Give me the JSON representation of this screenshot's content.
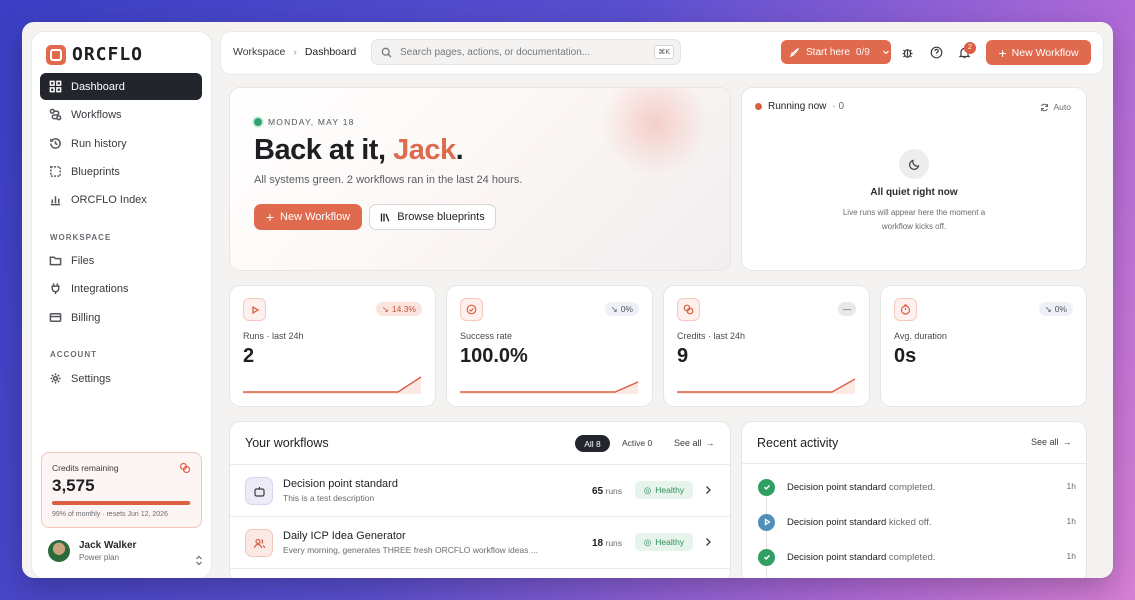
{
  "brand": {
    "name": "ORCFLO",
    "accent": "#e06a4e"
  },
  "sidebar": {
    "nav": [
      {
        "label": "Dashboard",
        "icon": "grid-icon",
        "active": true
      },
      {
        "label": "Workflows",
        "icon": "workflow-icon"
      },
      {
        "label": "Run history",
        "icon": "history-icon"
      },
      {
        "label": "Blueprints",
        "icon": "blueprint-icon"
      },
      {
        "label": "ORCFLO Index",
        "icon": "bar-chart-icon"
      }
    ],
    "workspace_label": "WORKSPACE",
    "workspace": [
      {
        "label": "Files",
        "icon": "folder-icon"
      },
      {
        "label": "Integrations",
        "icon": "plug-icon"
      },
      {
        "label": "Billing",
        "icon": "card-icon"
      }
    ],
    "account_label": "ACCOUNT",
    "account": [
      {
        "label": "Settings",
        "icon": "gear-icon"
      }
    ],
    "credits": {
      "label": "Credits remaining",
      "value": "3,575",
      "percent": 99,
      "sub": "99% of monthly · resets Jun 12, 2026"
    },
    "user": {
      "name": "Jack Walker",
      "plan": "Power plan"
    }
  },
  "topbar": {
    "crumb_root": "Workspace",
    "crumb_sep": "›",
    "crumb_current": "Dashboard",
    "search_placeholder": "Search pages, actions, or documentation...",
    "search_kbd": "⌘K",
    "start_here": "Start here",
    "start_progress": "0/9",
    "notif_count": "2",
    "new_workflow": "New Workflow"
  },
  "hero": {
    "date": "MONDAY, MAY 18",
    "greeting": "Back at it, ",
    "name": "Jack",
    "punct": ".",
    "status": "All systems green. 2 workflows ran in the last 24 hours.",
    "primary": "New Workflow",
    "secondary": "Browse blueprints"
  },
  "running": {
    "title": "Running now",
    "count": "· 0",
    "auto": "Auto",
    "empty_title": "All quiet right now",
    "empty_sub": "Live runs will appear here the moment a workflow kicks off."
  },
  "stats": [
    {
      "label": "Runs · last 24h",
      "value": "2",
      "change": "14.3%",
      "tone": "down"
    },
    {
      "label": "Success rate",
      "value": "100.0%",
      "change": "0%",
      "tone": "neutral"
    },
    {
      "label": "Credits · last 24h",
      "value": "9",
      "change": "—",
      "tone": "flat"
    },
    {
      "label": "Avg. duration",
      "value": "0s",
      "change": "0%",
      "tone": "neutral"
    }
  ],
  "workflows": {
    "title": "Your workflows",
    "filter_all": "All 8",
    "filter_active": "Active 0",
    "see_all": "See all",
    "rows": [
      {
        "title": "Decision point standard",
        "desc": "This is a test description",
        "runs": "65",
        "runs_unit": "runs",
        "status": "Healthy"
      },
      {
        "title": "Daily ICP Idea Generator",
        "desc": "Every morning, generates THREE fresh ORCFLO workflow ideas ...",
        "runs": "18",
        "runs_unit": "runs",
        "status": "Healthy"
      }
    ]
  },
  "activity": {
    "title": "Recent activity",
    "see_all": "See all",
    "rows": [
      {
        "name": "Decision point standard",
        "verb": " completed.",
        "time": "1h",
        "kind": "done"
      },
      {
        "name": "Decision point standard",
        "verb": " kicked off.",
        "time": "1h",
        "kind": "start"
      },
      {
        "name": "Decision point standard",
        "verb": " completed.",
        "time": "1h",
        "kind": "done"
      }
    ]
  }
}
